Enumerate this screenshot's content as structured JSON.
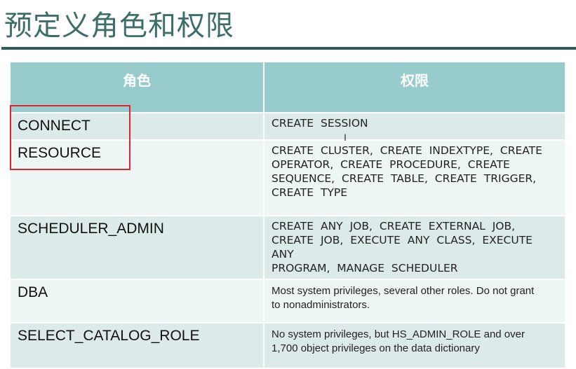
{
  "title": "预定义角色和权限",
  "table": {
    "headers": [
      "角色",
      "权限"
    ],
    "rows": [
      {
        "role": "CONNECT",
        "privileges": [
          "CREATE SESSION"
        ]
      },
      {
        "role": "RESOURCE",
        "privileges": [
          "CREATE CLUSTER, CREATE INDEXTYPE, CREATE",
          "OPERATOR, CREATE PROCEDURE, CREATE",
          "SEQUENCE, CREATE TABLE, CREATE TRIGGER,",
          "CREATE TYPE"
        ]
      },
      {
        "role": "SCHEDULER_ADMIN",
        "privileges": [
          "CREATE ANY JOB, CREATE EXTERNAL JOB,",
          "CREATE JOB, EXECUTE ANY CLASS, EXECUTE ANY",
          "PROGRAM, MANAGE SCHEDULER"
        ]
      },
      {
        "role": "DBA",
        "privileges": [
          "Most system privileges, several other roles. Do not grant",
          "to nonadministrators."
        ]
      },
      {
        "role": "SELECT_CATALOG_ROLE",
        "privileges": [
          "No system privileges, but HS_ADMIN_ROLE and over",
          "1,700 object privileges on the data dictionary"
        ]
      }
    ]
  },
  "colors": {
    "header": "#98cbcb",
    "row_dark": "#dcebea",
    "row_light": "#eef6f5",
    "rule": "#2f5e59",
    "highlight": "#e0262a"
  }
}
